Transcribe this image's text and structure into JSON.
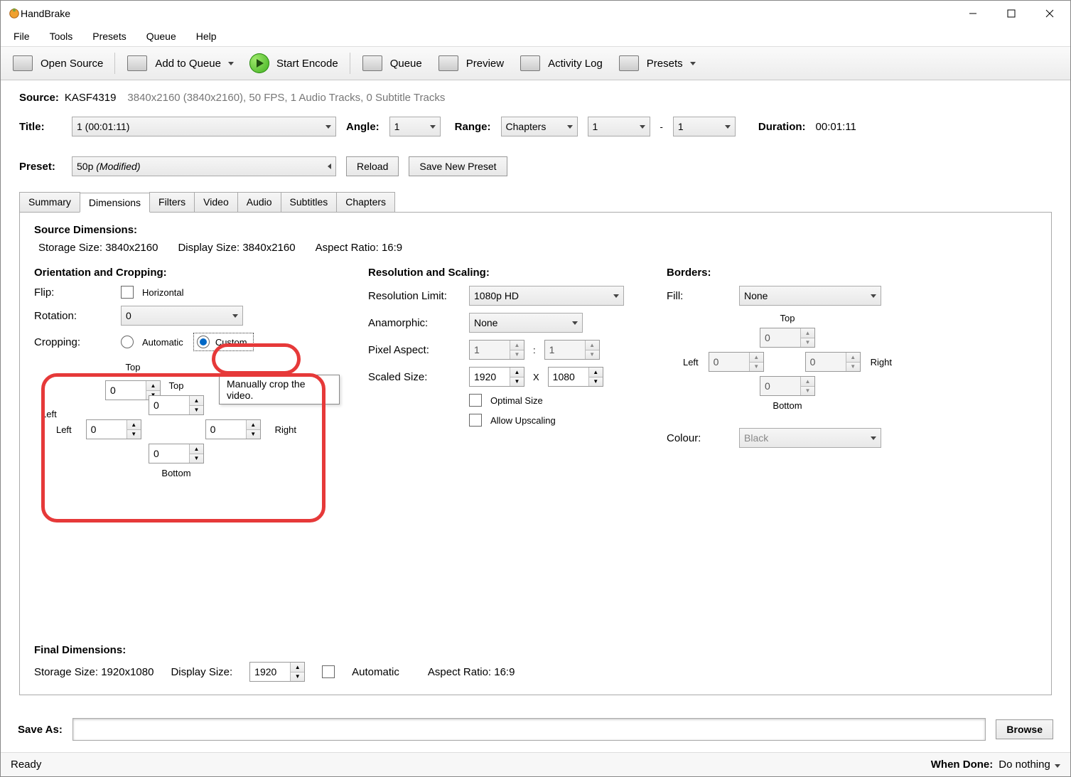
{
  "window": {
    "title": "HandBrake"
  },
  "menubar": [
    "File",
    "Tools",
    "Presets",
    "Queue",
    "Help"
  ],
  "toolbar": {
    "open_source": "Open Source",
    "add_to_queue": "Add to Queue",
    "start_encode": "Start Encode",
    "queue": "Queue",
    "preview": "Preview",
    "activity_log": "Activity Log",
    "presets": "Presets"
  },
  "source": {
    "label": "Source:",
    "name": "KASF4319",
    "details": "3840x2160 (3840x2160), 50 FPS, 1 Audio Tracks, 0 Subtitle Tracks"
  },
  "title_row": {
    "title_label": "Title:",
    "title_value": "1  (00:01:11)",
    "angle_label": "Angle:",
    "angle_value": "1",
    "range_label": "Range:",
    "range_type": "Chapters",
    "range_from": "1",
    "range_dash": "-",
    "range_to": "1",
    "duration_label": "Duration:",
    "duration_value": "00:01:11"
  },
  "preset_row": {
    "label": "Preset:",
    "value_main": "50p",
    "value_suffix": "(Modified)",
    "reload": "Reload",
    "save_new": "Save New Preset"
  },
  "tabs": [
    "Summary",
    "Dimensions",
    "Filters",
    "Video",
    "Audio",
    "Subtitles",
    "Chapters"
  ],
  "active_tab": "Dimensions",
  "dimensions": {
    "source_dims_title": "Source Dimensions:",
    "storage_size": "Storage Size: 3840x2160",
    "display_size": "Display Size: 3840x2160",
    "aspect": "Aspect Ratio: 16:9",
    "orientation_title": "Orientation and Cropping:",
    "flip_label": "Flip:",
    "flip_option": "Horizontal",
    "rotation_label": "Rotation:",
    "rotation_value": "0",
    "cropping_label": "Cropping:",
    "cropping_auto": "Automatic",
    "cropping_custom": "Custom",
    "tooltip": "Manually crop the video.",
    "crop": {
      "top_label": "Top",
      "left_label": "Left",
      "right_label": "Right",
      "bottom_label": "Bottom",
      "top": "0",
      "left": "0",
      "right": "0",
      "bottom": "0"
    },
    "resolution_title": "Resolution and Scaling:",
    "res_limit_label": "Resolution Limit:",
    "res_limit_value": "1080p HD",
    "anamorphic_label": "Anamorphic:",
    "anamorphic_value": "None",
    "pixel_aspect_label": "Pixel Aspect:",
    "pixel_aspect_colon": ":",
    "pixel_aspect_w": "1",
    "pixel_aspect_h": "1",
    "scaled_label": "Scaled Size:",
    "scaled_x": "X",
    "scaled_w": "1920",
    "scaled_h": "1080",
    "optimal": "Optimal Size",
    "upscale": "Allow Upscaling",
    "borders_title": "Borders:",
    "fill_label": "Fill:",
    "fill_value": "None",
    "border": {
      "top_label": "Top",
      "left_label": "Left",
      "right_label": "Right",
      "bottom_label": "Bottom",
      "top": "0",
      "left": "0",
      "right": "0",
      "bottom": "0"
    },
    "colour_label": "Colour:",
    "colour_value": "Black",
    "final_title": "Final Dimensions:",
    "final_storage": "Storage Size: 1920x1080",
    "final_display_label": "Display Size:",
    "final_display_value": "1920",
    "final_auto": "Automatic",
    "final_aspect": "Aspect Ratio: 16:9"
  },
  "saveas": {
    "label": "Save As:",
    "value": "",
    "browse": "Browse"
  },
  "statusbar": {
    "status": "Ready",
    "when_done_label": "When Done:",
    "when_done_value": "Do nothing"
  }
}
